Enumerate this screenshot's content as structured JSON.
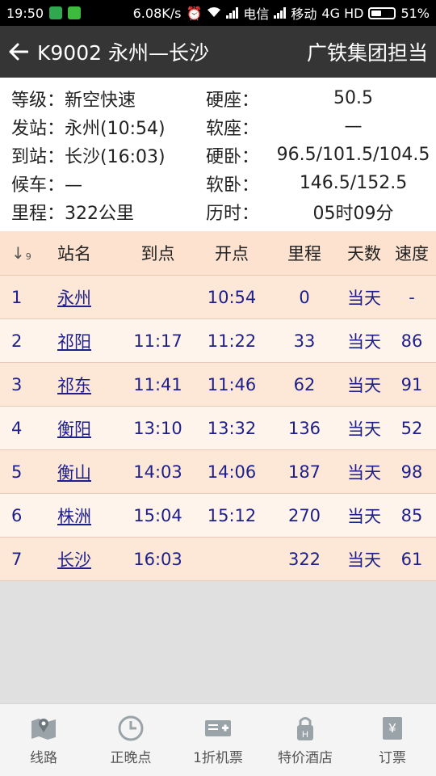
{
  "status_bar": {
    "time": "19:50",
    "speed": "6.08K/s",
    "carrier1": "电信",
    "carrier2": "移动",
    "network": "4G HD",
    "battery": "51%"
  },
  "header": {
    "title": "K9002 永州—长沙",
    "bureau": "广铁集团担当"
  },
  "info": [
    {
      "left": "等级：新空快速",
      "right_key": "硬座：",
      "right_val": "50.5"
    },
    {
      "left": "发站：永州(10:54)",
      "right_key": "软座：",
      "right_val": "—"
    },
    {
      "left": "到站：长沙(16:03)",
      "right_key": "硬卧：",
      "right_val": "96.5/101.5/104.5"
    },
    {
      "left": "候车：—",
      "right_key": "软卧：",
      "right_val": "146.5/152.5"
    },
    {
      "left": "里程：322公里",
      "right_key": "历时：",
      "right_val": "05时09分"
    }
  ],
  "table": {
    "sort_glyph": "↓",
    "sort_sub": "9",
    "headers": [
      "站名",
      "到点",
      "开点",
      "里程",
      "天数",
      "速度"
    ],
    "rows": [
      [
        "1",
        "永州",
        "",
        "10:54",
        "0",
        "当天",
        "-"
      ],
      [
        "2",
        "祁阳",
        "11:17",
        "11:22",
        "33",
        "当天",
        "86"
      ],
      [
        "3",
        "祁东",
        "11:41",
        "11:46",
        "62",
        "当天",
        "91"
      ],
      [
        "4",
        "衡阳",
        "13:10",
        "13:32",
        "136",
        "当天",
        "52"
      ],
      [
        "5",
        "衡山",
        "14:03",
        "14:06",
        "187",
        "当天",
        "98"
      ],
      [
        "6",
        "株洲",
        "15:04",
        "15:12",
        "270",
        "当天",
        "85"
      ],
      [
        "7",
        "长沙",
        "16:03",
        "",
        "322",
        "当天",
        "61"
      ]
    ]
  },
  "nav": [
    {
      "label": "线路",
      "icon": "map-icon"
    },
    {
      "label": "正晚点",
      "icon": "clock-icon"
    },
    {
      "label": "1折机票",
      "icon": "ticket-plus-icon"
    },
    {
      "label": "特价酒店",
      "icon": "hotel-lock-icon"
    },
    {
      "label": "订票",
      "icon": "yen-ticket-icon"
    }
  ],
  "colors": {
    "appbar": "#353535",
    "row_even": "#fde7d6",
    "row_odd": "#fff4ec",
    "text_blue": "#1d1f8a"
  },
  "battery_level": 0.51
}
